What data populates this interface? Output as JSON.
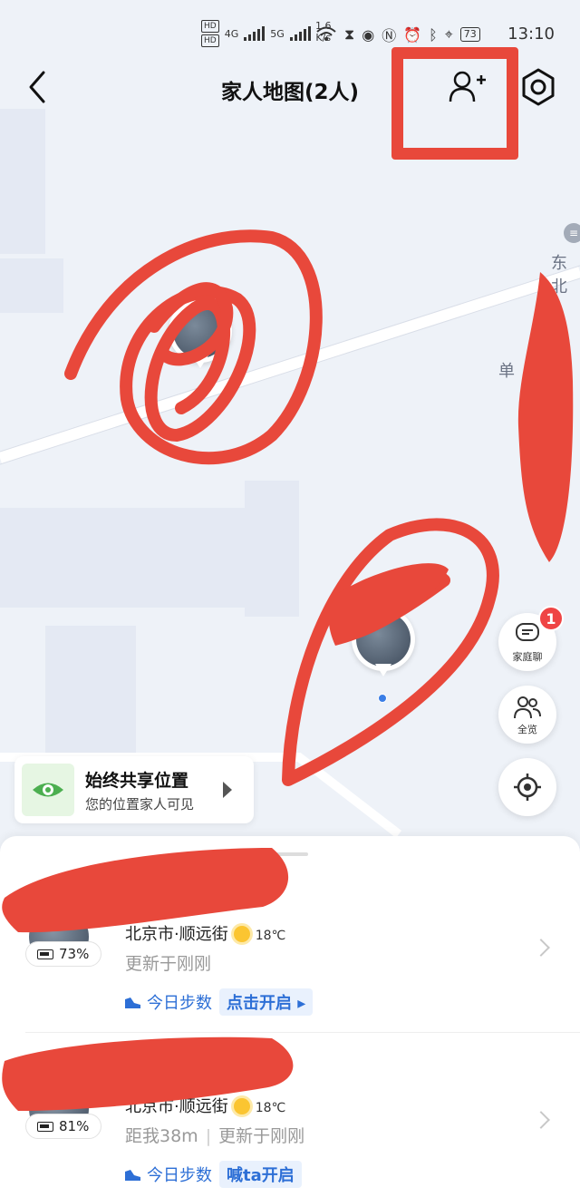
{
  "status_bar": {
    "net_tags": [
      "HD",
      "HD"
    ],
    "sig1_label": "4G",
    "sig2_label": "5G",
    "speed_value": "1.6",
    "speed_unit": "K/s",
    "battery": "73",
    "time": "13:10"
  },
  "header": {
    "title": "家人地图(2人)"
  },
  "map": {
    "labels": [
      "东北",
      "单",
      "东"
    ]
  },
  "fabs": {
    "chat_label": "家庭聊",
    "chat_badge": "1",
    "overview_label": "全览"
  },
  "share_card": {
    "title": "始终共享位置",
    "subtitle": "您的位置家人可见"
  },
  "members": [
    {
      "battery": "73%",
      "location": "北京市·顺远街",
      "temperature": "18℃",
      "distance": "",
      "updated": "更新于刚刚",
      "steps_label": "今日步数",
      "steps_action": "点击开启"
    },
    {
      "battery": "81%",
      "location": "北京市·顺远街",
      "temperature": "18℃",
      "distance": "距我38m",
      "updated": "更新于刚刚",
      "steps_label": "今日步数",
      "steps_action": "喊ta开启"
    }
  ],
  "colors": {
    "annotation_red": "#e8483b",
    "accent_blue": "#2d6fd6",
    "badge_red": "#ef4444",
    "eye_green": "#4caf50"
  }
}
